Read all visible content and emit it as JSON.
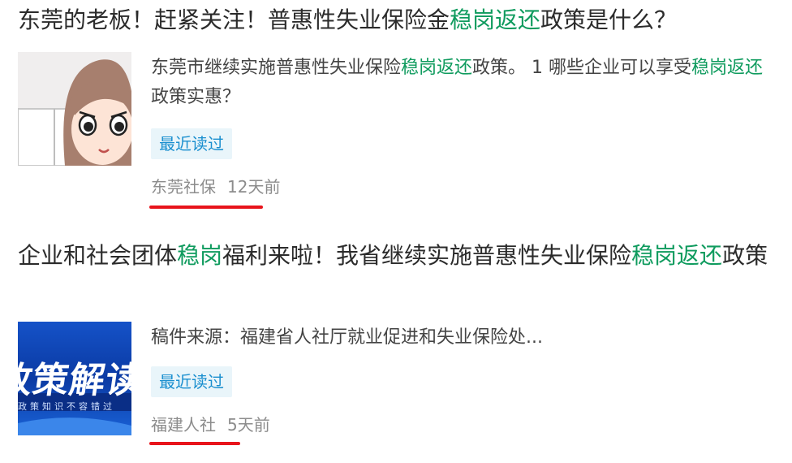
{
  "feed": {
    "items": [
      {
        "title_parts": [
          "东莞的老板！赶紧关注！普惠性失业保险金",
          "稳岗返还",
          "政策是什么？"
        ],
        "snippet_parts": [
          "东莞市继续实施普惠性失业保险",
          "稳岗返还",
          "政策。 1 哪些企业可以享受",
          "稳岗返还",
          "政策实惠？"
        ],
        "badge": "最近读过",
        "source": "东莞社保",
        "time": "12天前",
        "thumbnail": "cartoon-woman-avatar"
      },
      {
        "title_parts": [
          "企业和社会团体",
          "稳岗",
          "福利来啦！我省继续实施普惠性失业保险",
          "稳岗返还",
          "政策"
        ],
        "snippet": "稿件来源：福建省人社厅就业促进和失业保险处...",
        "badge": "最近读过",
        "source": "福建人社",
        "time": "5天前",
        "thumbnail_text": "政策解读",
        "thumbnail_subtext": "政策知识不容错过"
      }
    ]
  },
  "colors": {
    "highlight": "#0f9b5e",
    "badge_text": "#1a8fcf",
    "badge_bg": "#e9f5fa",
    "underline": "#e8141b",
    "meta": "#8c8c8c"
  }
}
